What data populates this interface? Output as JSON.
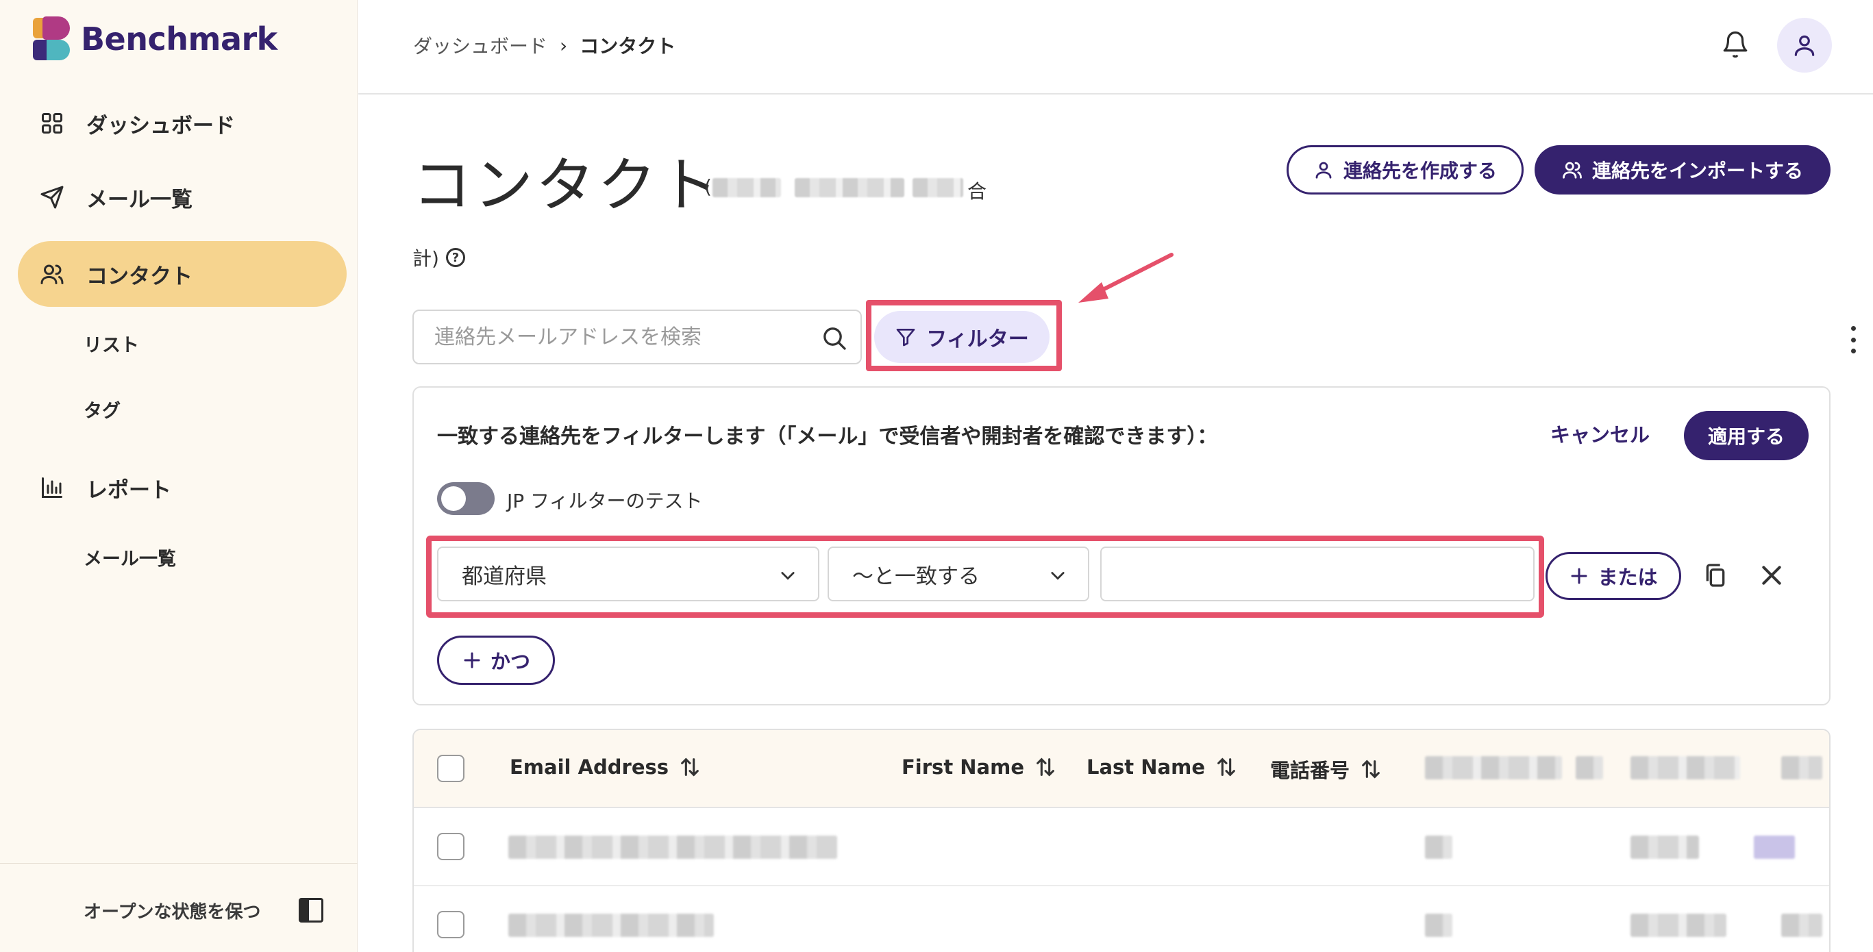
{
  "brand": {
    "name": "Benchmark"
  },
  "sidebar": {
    "items": [
      {
        "label": "ダッシュボード",
        "icon": "grid-icon"
      },
      {
        "label": "メール一覧",
        "icon": "send-icon"
      },
      {
        "label": "コンタクト",
        "icon": "users-icon",
        "active": true
      },
      {
        "label": "レポート",
        "icon": "bar-chart-icon"
      }
    ],
    "sub_contacts": [
      "リスト",
      "タグ"
    ],
    "sub_reports": [
      "メール一覧"
    ],
    "footer_label": "オープンな状態を保つ"
  },
  "breadcrumb": {
    "parent": "ダッシュボード",
    "separator": "›",
    "current": "コンタクト"
  },
  "page": {
    "title": "コンタクト",
    "count_open": "(",
    "count_end": "合",
    "count_line2": "計)",
    "help_glyph": "?"
  },
  "actions": {
    "create_label": "連絡先を作成する",
    "import_label": "連絡先をインポートする"
  },
  "search": {
    "placeholder": "連絡先メールアドレスを検索",
    "value": ""
  },
  "filter_button": {
    "label": "フィルター"
  },
  "filter_panel": {
    "title": "一致する連絡先をフィルターします（「メール」で受信者や開封者を確認できます）：",
    "cancel_label": "キャンセル",
    "apply_label": "適用する",
    "toggle_label": "JP フィルターのテスト",
    "toggle_on": false,
    "field_value": "都道府県",
    "operator_value": "〜と一致する",
    "text_value": "",
    "or_label": "または",
    "and_label": "かつ"
  },
  "table": {
    "columns": [
      "Email Address",
      "First Name",
      "Last Name",
      "電話番号"
    ]
  },
  "colors": {
    "brand": "#35226e",
    "active_nav": "#f6d48f",
    "highlight": "#e5506a",
    "sidebar_bg": "#fdf9f1"
  }
}
